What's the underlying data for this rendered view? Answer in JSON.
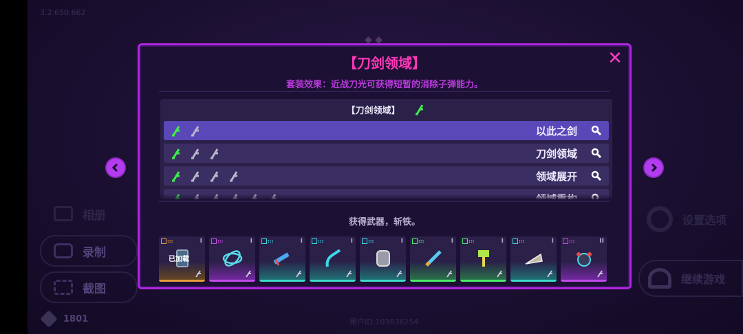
{
  "background": {
    "version": "3.2.650.662",
    "buttons": [
      {
        "label": "相册"
      },
      {
        "label": "录制"
      },
      {
        "label": "截图"
      }
    ],
    "gems": "1801",
    "user_id": "用户ID:103836254",
    "settings_label": "设置选项",
    "continue_label": "继续游戏"
  },
  "modal": {
    "title": "【刀剑领域】",
    "set_effect": "套装效果：近战刀光可获得短暂的消除子弹能力。",
    "set_header": "【刀剑领域】",
    "rows": [
      {
        "name": "以此之剑",
        "count": 2
      },
      {
        "name": "刀剑领域",
        "count": 3
      },
      {
        "name": "领域展开",
        "count": 4
      },
      {
        "name": "领域重构",
        "count": 6
      }
    ],
    "acquired_text": "获得武器，斩铁。",
    "weapons": [
      {
        "tier": "I",
        "rarity": "orange",
        "loaded_label": "已加载",
        "icon": "chip-icon"
      },
      {
        "tier": "I",
        "rarity": "purple",
        "icon": "orbit-icon"
      },
      {
        "tier": "I",
        "rarity": "teal",
        "icon": "dagger-icon"
      },
      {
        "tier": "I",
        "rarity": "teal",
        "icon": "hook-icon"
      },
      {
        "tier": "I",
        "rarity": "teal",
        "icon": "gauntlet-icon"
      },
      {
        "tier": "I",
        "rarity": "green",
        "icon": "knife-icon"
      },
      {
        "tier": "I",
        "rarity": "green",
        "icon": "hammer-icon"
      },
      {
        "tier": "I",
        "rarity": "teal",
        "icon": "drill-icon"
      },
      {
        "tier": "II",
        "rarity": "purple",
        "icon": "crab-icon"
      }
    ]
  },
  "colors": {
    "accent": "#b026e0",
    "title": "#ff38b8",
    "active_row": "#5a48b8"
  }
}
